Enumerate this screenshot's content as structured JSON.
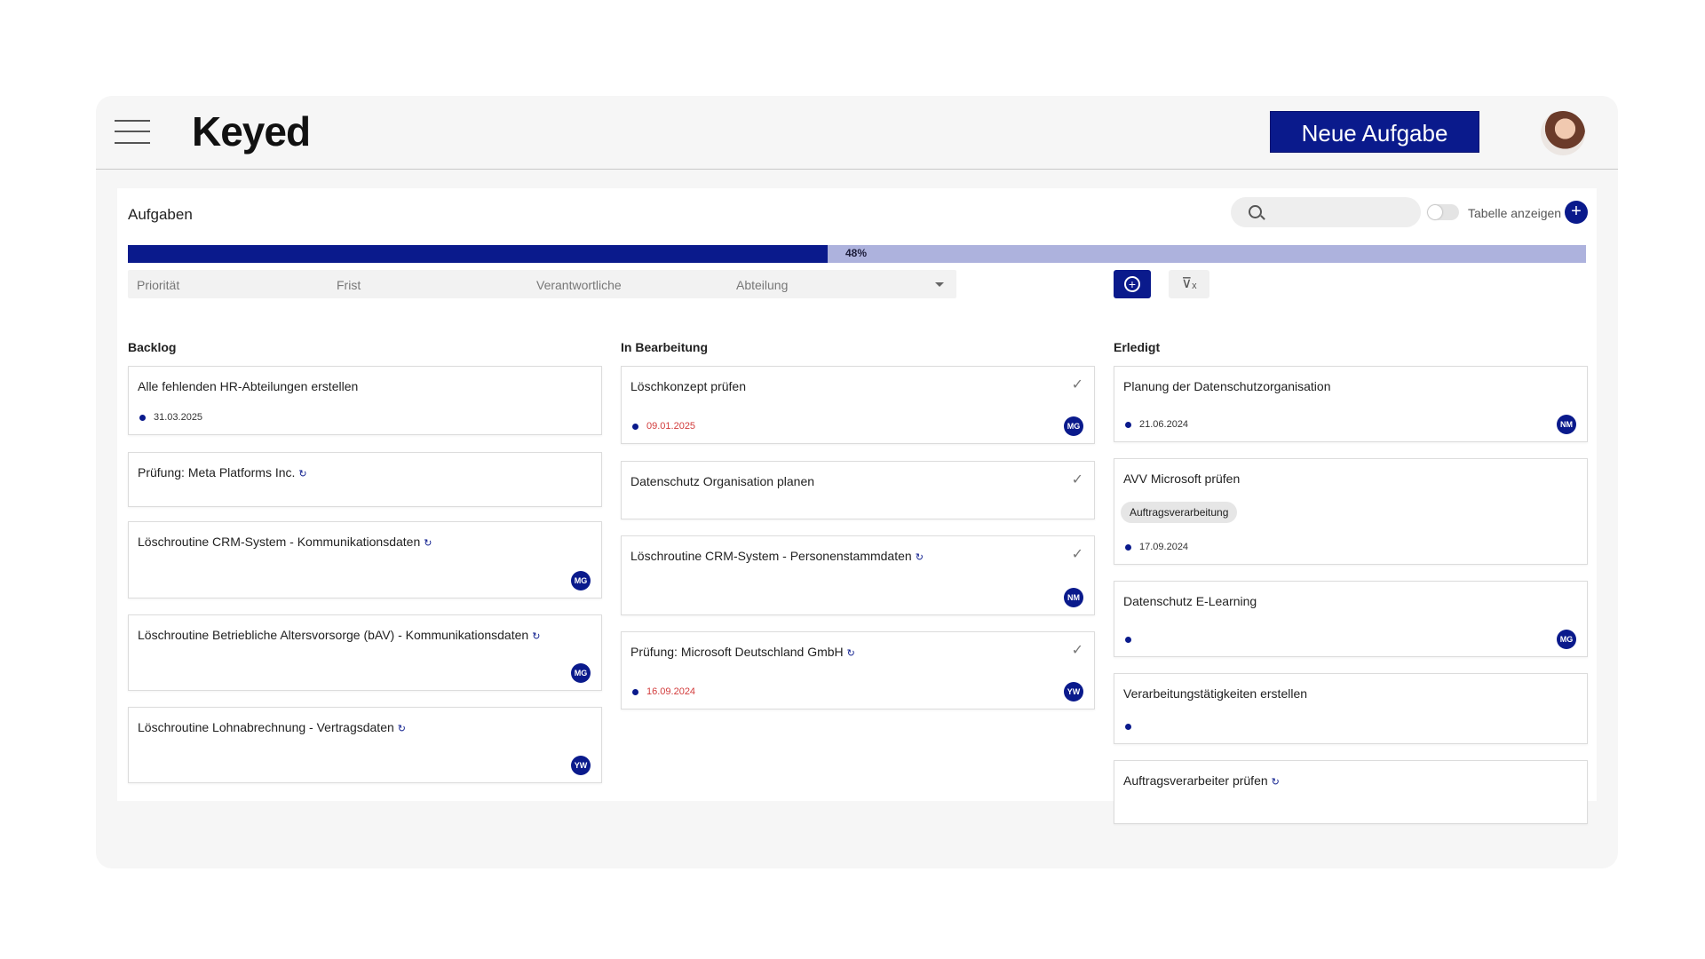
{
  "header": {
    "logo": "Keyed",
    "new_task": "Neue Aufgabe"
  },
  "panel": {
    "title": "Aufgaben",
    "toggle_label": "Tabelle anzeigen",
    "add_symbol": "+"
  },
  "progress": {
    "value": 0.48,
    "label": "48%"
  },
  "filters": [
    {
      "label": "Priorität"
    },
    {
      "label": "Frist"
    },
    {
      "label": "Verantwortliche"
    },
    {
      "label": "Abteilung"
    }
  ],
  "icons": {
    "menu": "menu-icon",
    "search": "search-icon",
    "add": "plus-circle-icon",
    "clear_filter": "filter-clear-icon",
    "sync": "sync-icon",
    "check": "check-icon",
    "sync_glyph": "↻",
    "check_glyph": "✓",
    "clear_glyph": "⊽ₓ",
    "add_glyph": "+"
  },
  "colors": {
    "primary": "#0a1a8c",
    "progress_track": "#adb2dd",
    "overdue": "#d23c3c"
  },
  "columns": [
    {
      "title": "Backlog",
      "cards": [
        {
          "title": "Alle fehlenden HR-Abteilungen erstellen",
          "date": "31.03.2025"
        },
        {
          "title": "Prüfung: Meta Platforms Inc."
        },
        {
          "title": "Löschroutine CRM-System - Kommunikationsdaten",
          "avatar": "MG"
        },
        {
          "title": "Löschroutine Betriebliche Altersvorsorge (bAV) - Kommunikationsdaten",
          "avatar": "MG"
        },
        {
          "title": "Löschroutine Lohnabrechnung - Vertragsdaten",
          "avatar": "YW"
        }
      ]
    },
    {
      "title": "In Bearbeitung",
      "cards": [
        {
          "title": "Löschkonzept prüfen",
          "date": "09.01.2025",
          "avatar": "MG"
        },
        {
          "title": "Datenschutz Organisation planen"
        },
        {
          "title": "Löschroutine CRM-System - Personenstammdaten",
          "avatar": "NM"
        },
        {
          "title": "Prüfung: Microsoft Deutschland GmbH",
          "date": "16.09.2024",
          "avatar": "YW"
        }
      ]
    },
    {
      "title": "Erledigt",
      "cards": [
        {
          "title": "Planung der Datenschutzorganisation",
          "date": "21.06.2024",
          "avatar": "NM"
        },
        {
          "title": "AVV Microsoft prüfen",
          "tag": "Auftragsverarbeitung",
          "date": "17.09.2024"
        },
        {
          "title": "Datenschutz E-Learning",
          "avatar": "MG"
        },
        {
          "title": "Verarbeitungstätigkeiten erstellen"
        },
        {
          "title": "Auftragsverarbeiter prüfen"
        }
      ]
    }
  ]
}
